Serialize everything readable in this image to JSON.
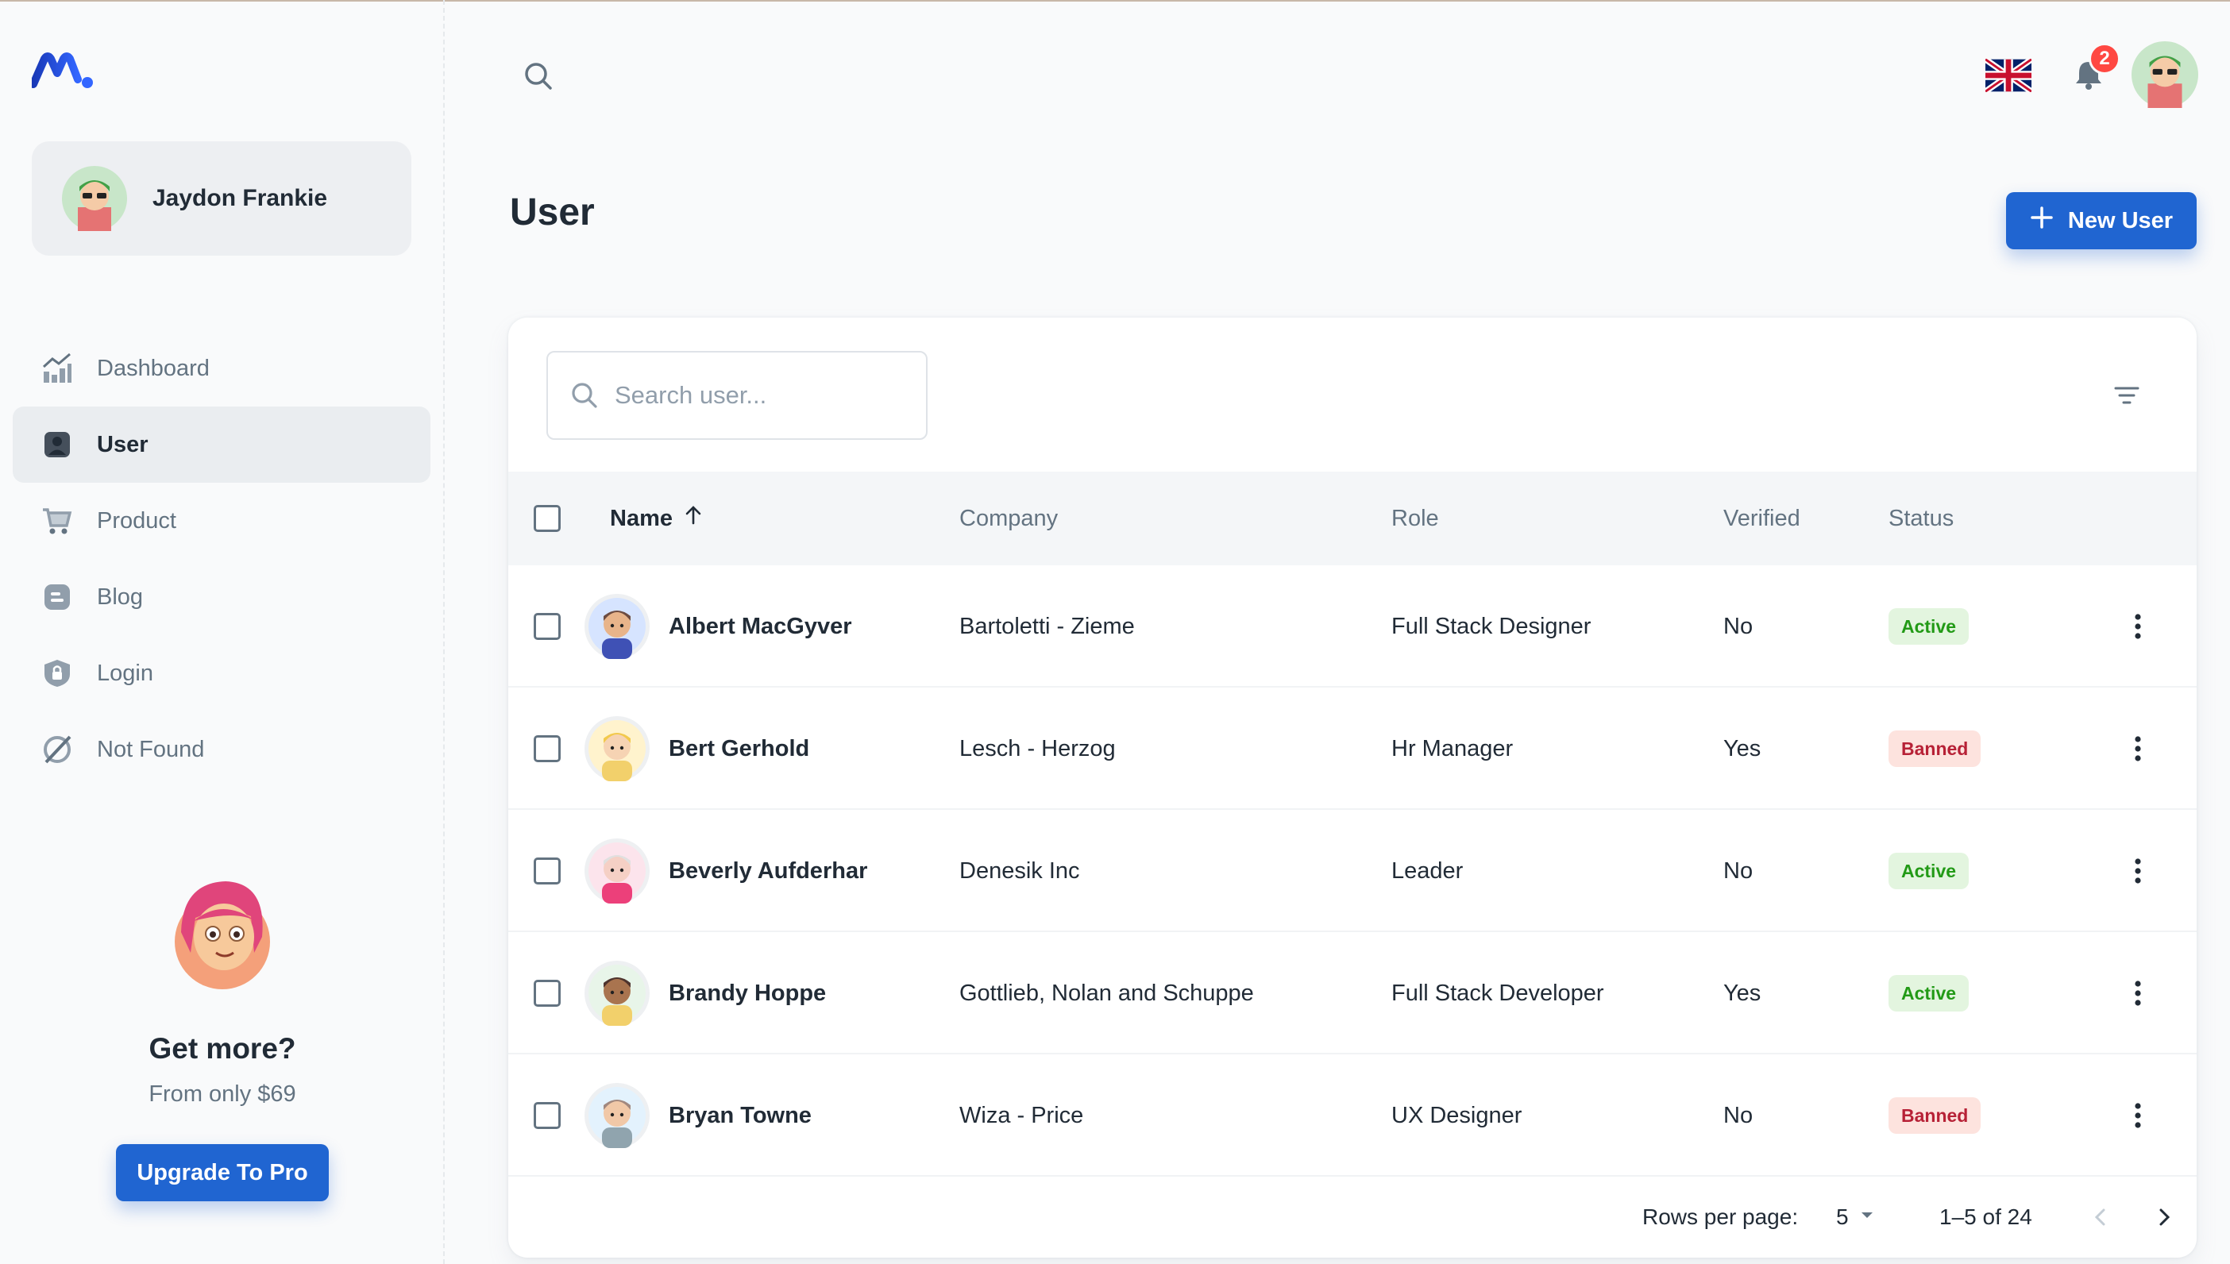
{
  "account": {
    "name": "Jaydon Frankie"
  },
  "nav": [
    {
      "label": "Dashboard",
      "icon": "analytics-icon"
    },
    {
      "label": "User",
      "icon": "user-icon",
      "active": true
    },
    {
      "label": "Product",
      "icon": "cart-icon"
    },
    {
      "label": "Blog",
      "icon": "blog-icon"
    },
    {
      "label": "Login",
      "icon": "lock-icon"
    },
    {
      "label": "Not Found",
      "icon": "disabled-icon"
    }
  ],
  "promo": {
    "title": "Get more?",
    "subtitle": "From only $69",
    "button": "Upgrade To Pro"
  },
  "header": {
    "notification_count": "2",
    "language": "English (UK)"
  },
  "page": {
    "title": "User",
    "new_button": "New User"
  },
  "table": {
    "search_placeholder": "Search user...",
    "columns": {
      "name": "Name",
      "company": "Company",
      "role": "Role",
      "verified": "Verified",
      "status": "Status"
    },
    "sort": {
      "column": "name",
      "direction": "asc"
    },
    "rows": [
      {
        "name": "Albert MacGyver",
        "company": "Bartoletti - Zieme",
        "role": "Full Stack Designer",
        "verified": "No",
        "status": "Active"
      },
      {
        "name": "Bert Gerhold",
        "company": "Lesch - Herzog",
        "role": "Hr Manager",
        "verified": "Yes",
        "status": "Banned"
      },
      {
        "name": "Beverly Aufderhar",
        "company": "Denesik Inc",
        "role": "Leader",
        "verified": "No",
        "status": "Active"
      },
      {
        "name": "Brandy Hoppe",
        "company": "Gottlieb, Nolan and Schuppe",
        "role": "Full Stack Developer",
        "verified": "Yes",
        "status": "Active"
      },
      {
        "name": "Bryan Towne",
        "company": "Wiza - Price",
        "role": "UX Designer",
        "verified": "No",
        "status": "Banned"
      }
    ],
    "pagination": {
      "rows_label": "Rows per page:",
      "rows_value": "5",
      "range": "1–5 of 24"
    }
  },
  "colors": {
    "primary": "#2065D1",
    "active_bg": "#E3F5DF",
    "active_text": "#229A16",
    "banned_bg": "#FDE3DE",
    "banned_text": "#B72136",
    "badge_red": "#FF4842"
  }
}
